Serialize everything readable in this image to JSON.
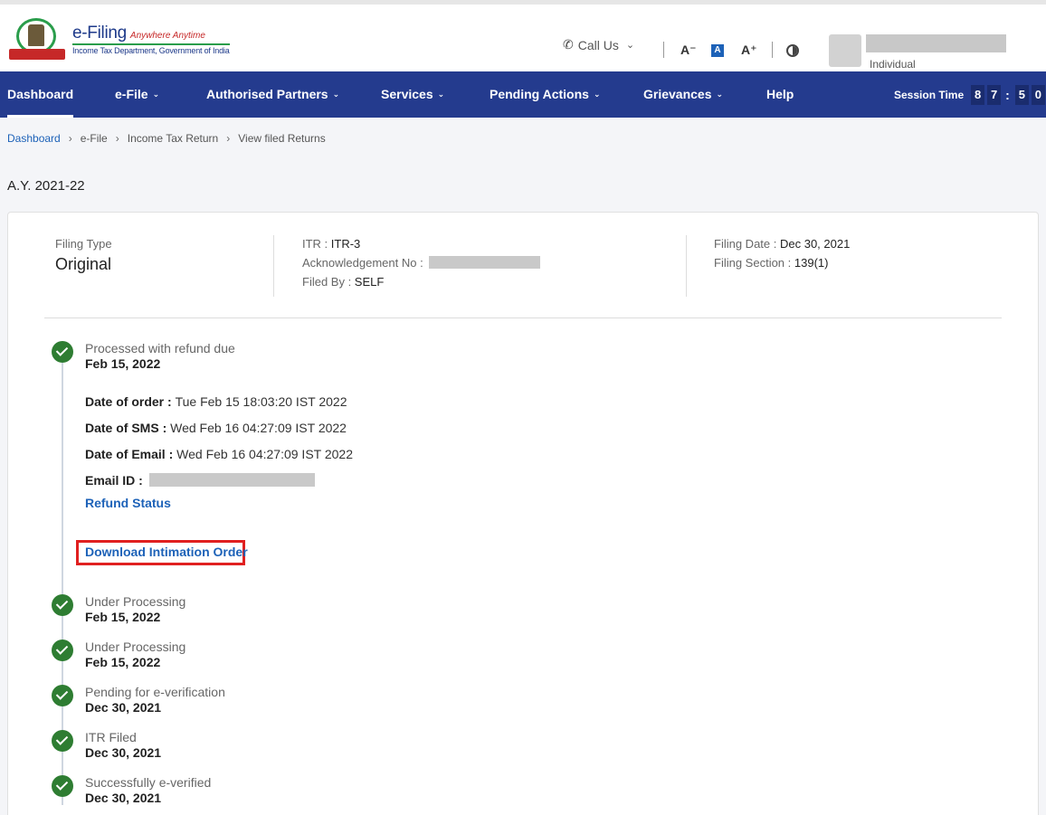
{
  "header": {
    "brand_title": "e-Filing",
    "brand_tagline": "Anywhere Anytime",
    "brand_subtitle": "Income Tax Department, Government of India",
    "call_us": "Call Us",
    "font_decrease": "A⁻",
    "font_normal": "A",
    "font_increase": "A⁺",
    "user_role": "Individual"
  },
  "nav": {
    "items": [
      {
        "label": "Dashboard",
        "active": true
      },
      {
        "label": "e-File"
      },
      {
        "label": "Authorised Partners"
      },
      {
        "label": "Services"
      },
      {
        "label": "Pending Actions"
      },
      {
        "label": "Grievances"
      },
      {
        "label": "Help"
      }
    ],
    "session_label": "Session Time",
    "session_digits": [
      "8",
      "7",
      "5",
      "0"
    ]
  },
  "breadcrumb": [
    "Dashboard",
    "e-File",
    "Income Tax Return",
    "View filed Returns"
  ],
  "assessment_year": "A.Y. 2021-22",
  "filing": {
    "type_label": "Filing Type",
    "type_value": "Original",
    "itr_label": "ITR : ",
    "itr_value": "ITR-3",
    "ack_label": "Acknowledgement No : ",
    "filed_by_label": "Filed By : ",
    "filed_by_value": "SELF",
    "date_label": "Filing Date : ",
    "date_value": "Dec 30, 2021",
    "section_label": "Filing Section : ",
    "section_value": "139(1)"
  },
  "timeline": [
    {
      "status": "Processed with refund due",
      "date": "Feb 15, 2022"
    },
    {
      "status": "Under Processing",
      "date": "Feb 15, 2022"
    },
    {
      "status": "Under Processing",
      "date": "Feb 15, 2022"
    },
    {
      "status": "Pending for e-verification",
      "date": "Dec 30, 2021"
    },
    {
      "status": "ITR Filed",
      "date": "Dec 30, 2021"
    },
    {
      "status": "Successfully e-verified",
      "date": "Dec 30, 2021"
    }
  ],
  "details": {
    "order_label": "Date of order : ",
    "order_value": "Tue Feb 15 18:03:20 IST 2022",
    "sms_label": "Date of SMS : ",
    "sms_value": "Wed Feb 16 04:27:09 IST 2022",
    "email_label": "Date of Email : ",
    "email_value": "Wed Feb 16 04:27:09 IST 2022",
    "email_id_label": "Email ID : ",
    "refund_status": "Refund Status",
    "download_intimation": "Download Intimation Order"
  },
  "colors": {
    "nav_bg": "#243b8e",
    "link": "#1d62b8",
    "success": "#2e7d32",
    "highlight": "#e02020"
  }
}
